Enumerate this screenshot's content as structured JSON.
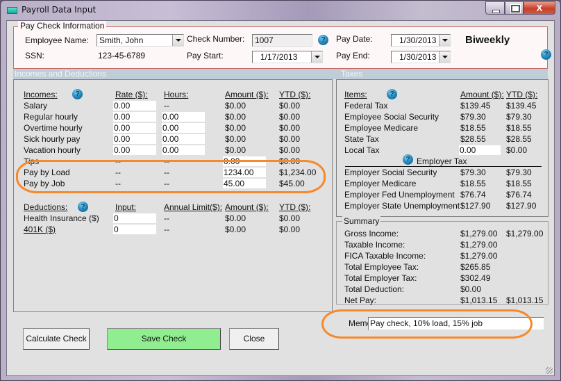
{
  "window": {
    "title": "Payroll Data Input",
    "controls": {
      "minimize": "minimize",
      "maximize": "maximize",
      "close": "X"
    }
  },
  "pay_check": {
    "legend": "Pay Check Information",
    "employee_name_label": "Employee Name:",
    "employee_name_value": "Smith, John",
    "ssn_label": "SSN:",
    "ssn_value": "123-45-6789",
    "check_number_label": "Check Number:",
    "check_number_value": "1007",
    "pay_start_label": "Pay Start:",
    "pay_start_value": "1/17/2013",
    "pay_date_label": "Pay Date:",
    "pay_date_value": "1/30/2013",
    "pay_end_label": "Pay End:",
    "pay_end_value": "1/30/2013",
    "frequency": "Biweekly",
    "help_glyph": "?"
  },
  "sections": {
    "incomes_deductions": "Incomes and Deductions",
    "taxes": "Taxes"
  },
  "incomes": {
    "headers": {
      "name": "Incomes:",
      "rate": "Rate ($):",
      "hours": "Hours:",
      "amount": "Amount ($):",
      "ytd": "YTD ($):"
    },
    "rows": [
      {
        "name": "Salary",
        "rate": "0.00",
        "hours": "--",
        "amount": "$0.00",
        "ytd": "$0.00"
      },
      {
        "name": "Regular hourly",
        "rate": "0.00",
        "hours": "0.00",
        "amount": "$0.00",
        "ytd": "$0.00"
      },
      {
        "name": "Overtime hourly",
        "rate": "0.00",
        "hours": "0.00",
        "amount": "$0.00",
        "ytd": "$0.00"
      },
      {
        "name": "Sick hourly pay",
        "rate": "0.00",
        "hours": "0.00",
        "amount": "$0.00",
        "ytd": "$0.00"
      },
      {
        "name": "Vacation hourly",
        "rate": "0.00",
        "hours": "0.00",
        "amount": "$0.00",
        "ytd": "$0.00"
      },
      {
        "name": "Tips",
        "rate": "--",
        "hours": "--",
        "amount": "0.00",
        "ytd": "$0.00"
      },
      {
        "name": "Pay by Load",
        "rate": "--",
        "hours": "--",
        "amount": "1234.00",
        "ytd": "$1,234.00"
      },
      {
        "name": "Pay by Job",
        "rate": "--",
        "hours": "--",
        "amount": "45.00",
        "ytd": "$45.00"
      }
    ]
  },
  "deductions": {
    "headers": {
      "name": "Deductions:",
      "input": "Input:",
      "limit": "Annual Limit($):",
      "amount": "Amount ($):",
      "ytd": "YTD ($):"
    },
    "rows": [
      {
        "name": "Health Insurance  ($)",
        "input": "0",
        "limit": "--",
        "amount": "$0.00",
        "ytd": "$0.00"
      },
      {
        "name": "401K  ($)",
        "input": "0",
        "limit": "--",
        "amount": "$0.00",
        "ytd": "$0.00"
      }
    ]
  },
  "taxes": {
    "headers": {
      "items": "Items:",
      "amount": "Amount ($):",
      "ytd": "YTD ($):"
    },
    "employee_rows": [
      {
        "name": "Federal Tax",
        "amount": "$139.45",
        "ytd": "$139.45"
      },
      {
        "name": "Employee Social Security",
        "amount": "$79.30",
        "ytd": "$79.30"
      },
      {
        "name": "Employee Medicare",
        "amount": "$18.55",
        "ytd": "$18.55"
      },
      {
        "name": "State Tax",
        "amount": "$28.55",
        "ytd": "$28.55"
      },
      {
        "name": "Local Tax",
        "amount": "0.00",
        "ytd": "$0.00"
      }
    ],
    "employer_label": "Employer Tax",
    "employer_rows": [
      {
        "name": "Employer Social Security",
        "amount": "$79.30",
        "ytd": "$79.30"
      },
      {
        "name": "Employer Medicare",
        "amount": "$18.55",
        "ytd": "$18.55"
      },
      {
        "name": "Employer Fed Unemployment",
        "amount": "$76.74",
        "ytd": "$76.74"
      },
      {
        "name": "Employer State Unemployment",
        "amount": "$127.90",
        "ytd": "$127.90"
      }
    ]
  },
  "summary": {
    "legend": "Summary",
    "rows": [
      {
        "name": "Gross Income:",
        "amount": "$1,279.00",
        "ytd": "$1,279.00"
      },
      {
        "name": "Taxable Income:",
        "amount": "$1,279.00",
        "ytd": ""
      },
      {
        "name": "FICA Taxable Income:",
        "amount": "$1,279.00",
        "ytd": ""
      },
      {
        "name": "Total Employee Tax:",
        "amount": "$265.85",
        "ytd": ""
      },
      {
        "name": "Total Employer Tax:",
        "amount": "$302.49",
        "ytd": ""
      },
      {
        "name": "Total Deduction:",
        "amount": "$0.00",
        "ytd": ""
      },
      {
        "name": "Net Pay:",
        "amount": "$1,013.15",
        "ytd": "$1,013.15"
      }
    ]
  },
  "memo": {
    "label": "Memo:",
    "value": "Pay check, 10% load, 15% job"
  },
  "buttons": {
    "calculate": "Calculate Check",
    "save": "Save Check",
    "close": "Close"
  },
  "annotation_color": "#f5892b"
}
